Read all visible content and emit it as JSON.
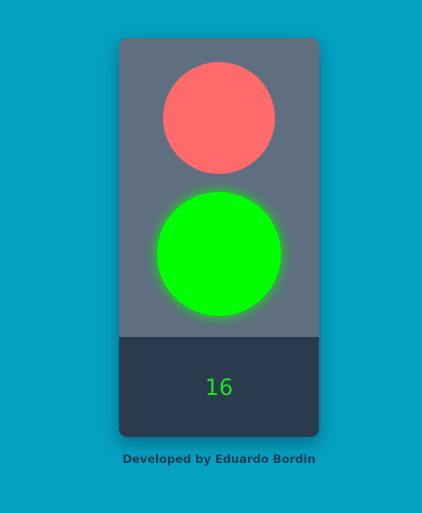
{
  "colors": {
    "background": "#05a1c3",
    "housing_top": "#5f6f7f",
    "housing_bottom": "#2a3b4e",
    "red_lamp": "#ff6b6b",
    "green_lamp": "#00ff00",
    "counter_text": "#22e11e",
    "footer_text": "#1c3d55"
  },
  "lights": {
    "red": {
      "state": "dim",
      "icon": "red-lamp-icon"
    },
    "green": {
      "state": "lit",
      "icon": "green-lamp-icon"
    }
  },
  "counter": {
    "value": "16"
  },
  "footer": {
    "credit": "Developed by Eduardo Bordin"
  }
}
